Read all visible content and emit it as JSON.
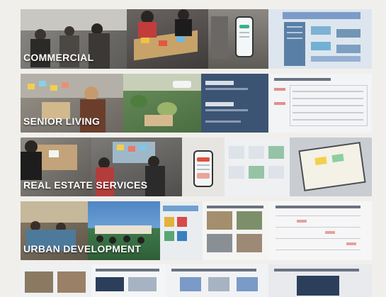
{
  "bands": [
    {
      "label": "COMMERCIAL"
    },
    {
      "label": "SENIOR LIVING"
    },
    {
      "label": "REAL ESTATE SERVICES"
    },
    {
      "label": "URBAN DEVELOPMENT"
    },
    {
      "label": ""
    }
  ],
  "colors": {
    "background": "#f1efec",
    "label_text": "#ffffff",
    "accent_blue": "#2b5fa8",
    "accent_red": "#d74a4a"
  }
}
